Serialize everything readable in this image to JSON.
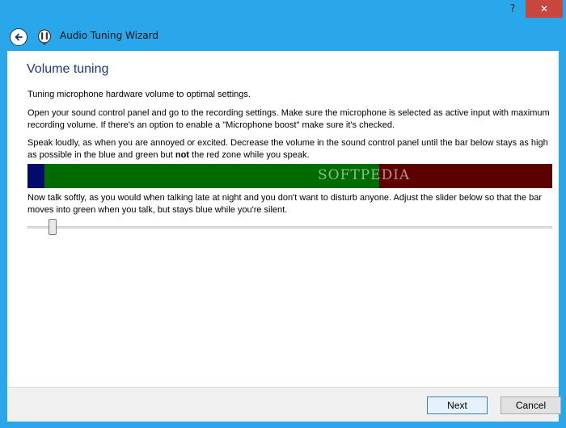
{
  "titlebar": {
    "help_label": "?",
    "min_label": "–",
    "close_label": "✕"
  },
  "header": {
    "title": "Audio Tuning Wizard",
    "back_icon": "back-arrow-icon",
    "app_icon": "microphone-app-icon"
  },
  "page": {
    "heading": "Volume tuning",
    "intro": "Tuning microphone hardware volume to optimal settings.",
    "instructions": "Open your sound control panel and go to the recording settings. Make sure the microphone is selected as active input with maximum recording volume. If there's an option to enable a \"Microphone boost\" make sure it's checked.",
    "loud_before": "Speak loudly, as when you are annoyed or excited. Decrease the volume in the sound control panel until the bar below stays as high as possible in the blue and green but ",
    "loud_bold": "not",
    "loud_after": " the red zone while you speak.",
    "soft": "Now talk softly, as you would when talking late at night and you don't want to disturb anyone. Adjust the slider below so that the bar moves into green when you talk, but stays blue while you're silent.",
    "watermark": "SOFTPEDIA"
  },
  "meter": {
    "colors": {
      "blue": "#000c6b",
      "green": "#006b00",
      "red": "#5c0000"
    }
  },
  "slider": {
    "value_fraction": 0.04
  },
  "footer": {
    "next_label": "Next",
    "cancel_label": "Cancel"
  },
  "colors": {
    "accent": "#2aa7ea",
    "close": "#c7463d",
    "heading": "#1e3a78"
  }
}
